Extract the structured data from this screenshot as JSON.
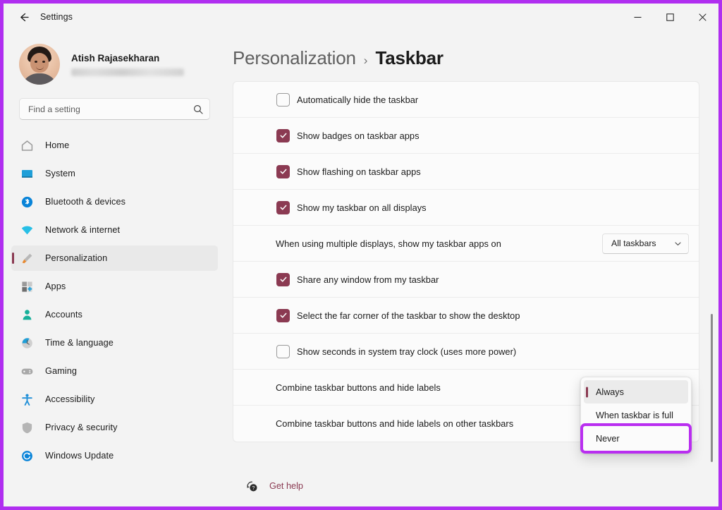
{
  "window": {
    "app_title": "Settings",
    "back_icon": "back-arrow-icon",
    "accent_border_color": "#b02ef0",
    "controls": {
      "minimize": "minimize-icon",
      "maximize": "maximize-icon",
      "close": "close-icon"
    }
  },
  "account": {
    "name": "Atish Rajasekharan",
    "email_redacted": true
  },
  "search": {
    "placeholder": "Find a setting",
    "value": "",
    "icon": "search-icon"
  },
  "sidebar": {
    "items": [
      {
        "label": "Home",
        "icon": "home-icon",
        "selected": false
      },
      {
        "label": "System",
        "icon": "system-monitor-icon",
        "selected": false
      },
      {
        "label": "Bluetooth & devices",
        "icon": "bluetooth-icon",
        "selected": false
      },
      {
        "label": "Network & internet",
        "icon": "wifi-icon",
        "selected": false
      },
      {
        "label": "Personalization",
        "icon": "paintbrush-icon",
        "selected": true
      },
      {
        "label": "Apps",
        "icon": "apps-grid-icon",
        "selected": false
      },
      {
        "label": "Accounts",
        "icon": "person-icon",
        "selected": false
      },
      {
        "label": "Time & language",
        "icon": "clock-globe-icon",
        "selected": false
      },
      {
        "label": "Gaming",
        "icon": "gamepad-icon",
        "selected": false
      },
      {
        "label": "Accessibility",
        "icon": "accessibility-person-icon",
        "selected": false
      },
      {
        "label": "Privacy & security",
        "icon": "shield-icon",
        "selected": false
      },
      {
        "label": "Windows Update",
        "icon": "update-refresh-icon",
        "selected": false
      }
    ]
  },
  "breadcrumb": {
    "parent": "Personalization",
    "separator": "›",
    "current": "Taskbar"
  },
  "settings_rows": [
    {
      "label": "Automatically hide the taskbar",
      "control": "checkbox",
      "checked": false
    },
    {
      "label": "Show badges on taskbar apps",
      "control": "checkbox",
      "checked": true
    },
    {
      "label": "Show flashing on taskbar apps",
      "control": "checkbox",
      "checked": true
    },
    {
      "label": "Show my taskbar on all displays",
      "control": "checkbox",
      "checked": true
    },
    {
      "label": "When using multiple displays, show my taskbar apps on",
      "control": "dropdown",
      "value": "All taskbars"
    },
    {
      "label": "Share any window from my taskbar",
      "control": "checkbox",
      "checked": true
    },
    {
      "label": "Select the far corner of the taskbar to show the desktop",
      "control": "checkbox",
      "checked": true
    },
    {
      "label": "Show seconds in system tray clock (uses more power)",
      "control": "checkbox",
      "checked": false
    },
    {
      "label": "Combine taskbar buttons and hide labels",
      "control": "dropdown-hidden",
      "value": ""
    },
    {
      "label": "Combine taskbar buttons and hide labels on other taskbars",
      "control": "dropdown-hidden",
      "value": ""
    }
  ],
  "flyout": {
    "options": [
      {
        "label": "Always",
        "selected": true,
        "highlighted": false
      },
      {
        "label": "When taskbar is full",
        "selected": false,
        "highlighted": false
      },
      {
        "label": "Never",
        "selected": false,
        "highlighted": true
      }
    ]
  },
  "footer": {
    "help_label": "Get help",
    "help_icon": "help-question-icon"
  },
  "colors": {
    "accent_checkbox": "#8b3a52",
    "annotation_highlight": "#b92ef0",
    "link": "#8b3a52",
    "window_border": "#b02ef0"
  }
}
